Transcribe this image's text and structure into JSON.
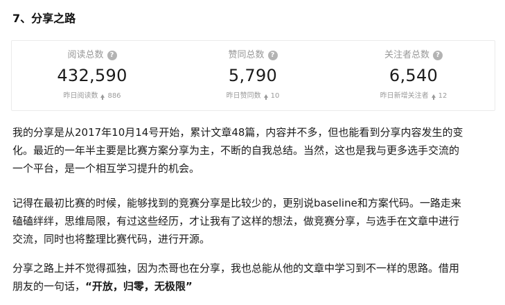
{
  "section": {
    "title": "7、分享之路"
  },
  "stats": [
    {
      "label": "阅读总数",
      "value": "432,590",
      "sub_label": "昨日阅读数",
      "sub_value": "886"
    },
    {
      "label": "赞同总数",
      "value": "5,790",
      "sub_label": "昨日赞同数",
      "sub_value": "10"
    },
    {
      "label": "关注者总数",
      "value": "6,540",
      "sub_label": "昨日新增关注者",
      "sub_value": "12"
    }
  ],
  "paragraphs": {
    "p1": [
      "我的分享是从2017年10月14号开始，累计文章48篇，内容并不多，但也能看到分享内容发生的变",
      "化。最近的一年半主要是比赛方案分享为主，不断的自我总结。当然，这也是我与更多选手交流的",
      "一个平台，是一个相互学习提升的机会。"
    ],
    "p2": [
      "记得在最初比赛的时候，能够找到的竞赛分享是比较少的，更别说baseline和方案代码。一路走来",
      "磕磕绊绊，思维局限，有过这些经历，才让我有了这样的想法，做竞赛分享，与选手在文章中进行",
      "交流，同时也将整理比赛代码，进行开源。"
    ],
    "p3": {
      "line1": "分享之路上并不觉得孤独，因为杰哥也在分享，我也总能从他的文章中学习到不一样的思路。借用",
      "line2_prefix": "朋友的一句话，",
      "line2_quote": "“开放，归零，无极限”"
    }
  },
  "icons": {
    "help": "question-circle-icon",
    "increase": "arrow-up-icon"
  },
  "colors": {
    "muted_text": "#999999",
    "body_text": "#1a1a1a",
    "help_icon_bg": "#b3b3b3"
  }
}
